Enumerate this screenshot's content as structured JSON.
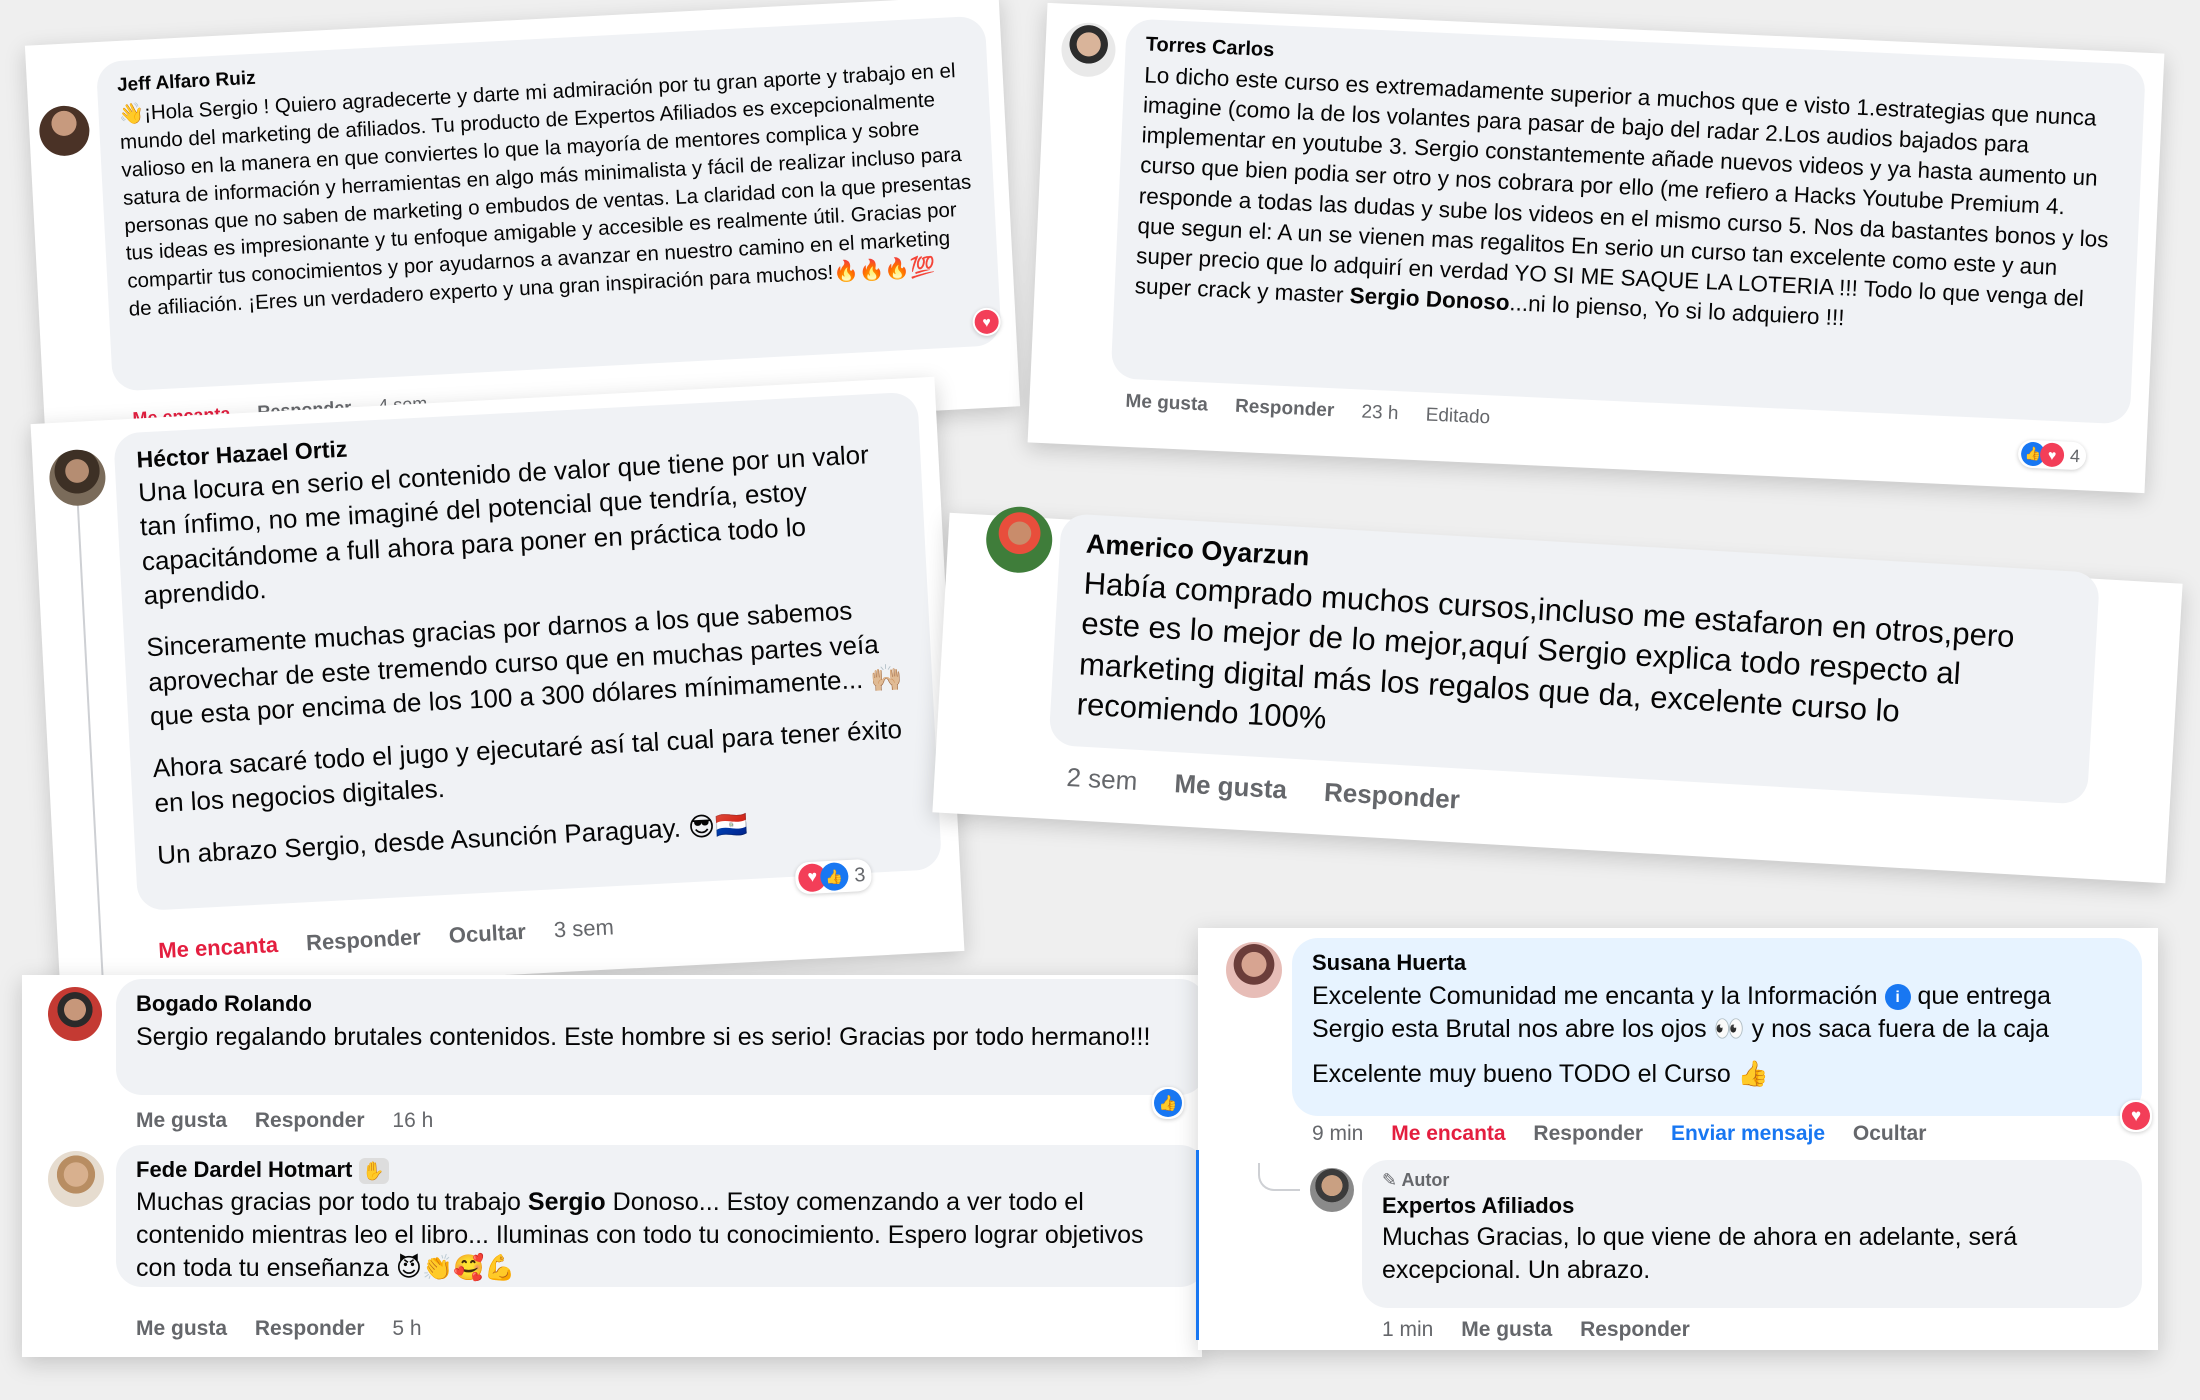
{
  "comments": {
    "jeff": {
      "name": "Jeff Alfaro Ruiz",
      "text": "👋¡Hola Sergio ! Quiero agradecerte y darte mi admiración por tu gran aporte y trabajo en el mundo del marketing de afiliados. Tu producto de Expertos Afiliados es excepcionalmente valioso en la manera en que conviertes lo que la mayoría de mentores complica y sobre satura de información y herramientas en algo más minimalista y fácil de realizar incluso para personas que no saben de marketing o embudos de ventas. La claridad con la que presentas tus ideas es impresionante y tu enfoque amigable y accesible es realmente útil. Gracias por compartir tus conocimientos y por ayudarnos a avanzar en nuestro camino en el marketing de afiliación. ¡Eres un verdadero experto y una gran inspiración para muchos!🔥🔥🔥💯",
      "action_love": "Me encanta",
      "action_reply": "Responder",
      "time": "4 sem"
    },
    "torres": {
      "name": "Torres Carlos",
      "text_main": "Lo dicho este curso es extremadamente superior a muchos que e visto 1.estrategias que nunca imagine (como la de los volantes para pasar de bajo del radar 2.Los audios bajados para implementar en youtube 3. Sergio constantemente añade nuevos videos y ya hasta aumento un curso que bien podia ser otro y nos cobrara por ello (me refiero a Hacks Youtube Premium 4. responde a todas las dudas y sube los videos en el mismo curso 5. Nos da bastantes bonos y los que segun el: A un se vienen mas regalitos En serio un curso tan excelente como este y aun super precio que lo adquirí en verdad YO SI ME SAQUE LA LOTERIA !!! Todo lo que venga del super crack y master",
      "text_bold": "Sergio Donoso",
      "text_end": "...ni lo pienso, Yo si lo adquiero !!!",
      "action_like": "Me gusta",
      "action_reply": "Responder",
      "time": "23 h",
      "edited": "Editado",
      "reaction_count": "4"
    },
    "hector": {
      "name": "Héctor Hazael Ortiz",
      "p1": "Una locura en serio el contenido de valor que tiene por un valor tan ínfimo, no me imaginé del potencial que tendría, estoy capacitándome a full ahora para poner en práctica todo lo aprendido.",
      "p2": "Sinceramente muchas gracias por darnos a los que sabemos aprovechar de este tremendo curso que en muchas partes veía que esta por encima de los 100 a 300 dólares mínimamente... 🙌🏼",
      "p3": "Ahora sacaré todo el jugo y ejecutaré así tal cual para tener éxito en los negocios digitales.",
      "p4": "Un abrazo Sergio, desde Asunción Paraguay. 😎🇵🇾",
      "action_love": "Me encanta",
      "action_reply": "Responder",
      "action_hide": "Ocultar",
      "time": "3 sem",
      "reaction_count": "3"
    },
    "americo": {
      "name": "Americo Oyarzun",
      "text": "Había comprado muchos cursos,incluso me estafaron en otros,pero este es lo mejor de lo mejor,aquí Sergio explica todo respecto al marketing digital más los regalos que da, excelente curso lo recomiendo 100%",
      "time": "2 sem",
      "action_like": "Me gusta",
      "action_reply": "Responder"
    },
    "bogado": {
      "name": "Bogado Rolando",
      "text": "Sergio regalando brutales contenidos. Este hombre si es serio! Gracias por todo hermano!!!",
      "action_like": "Me gusta",
      "action_reply": "Responder",
      "time": "16 h"
    },
    "fede": {
      "name": "Fede Dardel Hotmart",
      "text_start": "Muchas gracias por todo tu trabajo",
      "text_bold": "Sergio",
      "text_end": "Donoso... Estoy comenzando a ver todo el contenido mientras leo el libro... Iluminas con todo tu conocimiento. Espero lograr objetivos con toda tu enseñanza 😈👏🥰💪",
      "action_like": "Me gusta",
      "action_reply": "Responder",
      "time": "5 h"
    },
    "susana": {
      "name": "Susana Huerta",
      "line1_start": "Excelente Comunidad me encanta y la Información",
      "line1_end": "que entrega Sergio esta Brutal nos abre los ojos 👀 y nos saca fuera de la caja",
      "line2": "Excelente muy bueno TODO el Curso 👍",
      "time": "9 min",
      "action_love": "Me encanta",
      "action_reply": "Responder",
      "action_message": "Enviar mensaje",
      "action_hide": "Ocultar"
    },
    "expertos": {
      "badge": "Autor",
      "name": "Expertos Afiliados",
      "text": "Muchas Gracias, lo que viene de ahora en adelante, será excepcional. Un abrazo.",
      "time": "1 min",
      "action_like": "Me gusta",
      "action_reply": "Responder"
    }
  },
  "colors": {
    "bubble": "#f0f2f5",
    "link_red": "#e41e3f",
    "link_blue": "#1877f2",
    "meta_gray": "#65676b"
  },
  "icons": [
    "heart-reaction-icon",
    "like-reaction-icon",
    "pencil-icon",
    "info-icon",
    "wave-icon",
    "avatar"
  ]
}
